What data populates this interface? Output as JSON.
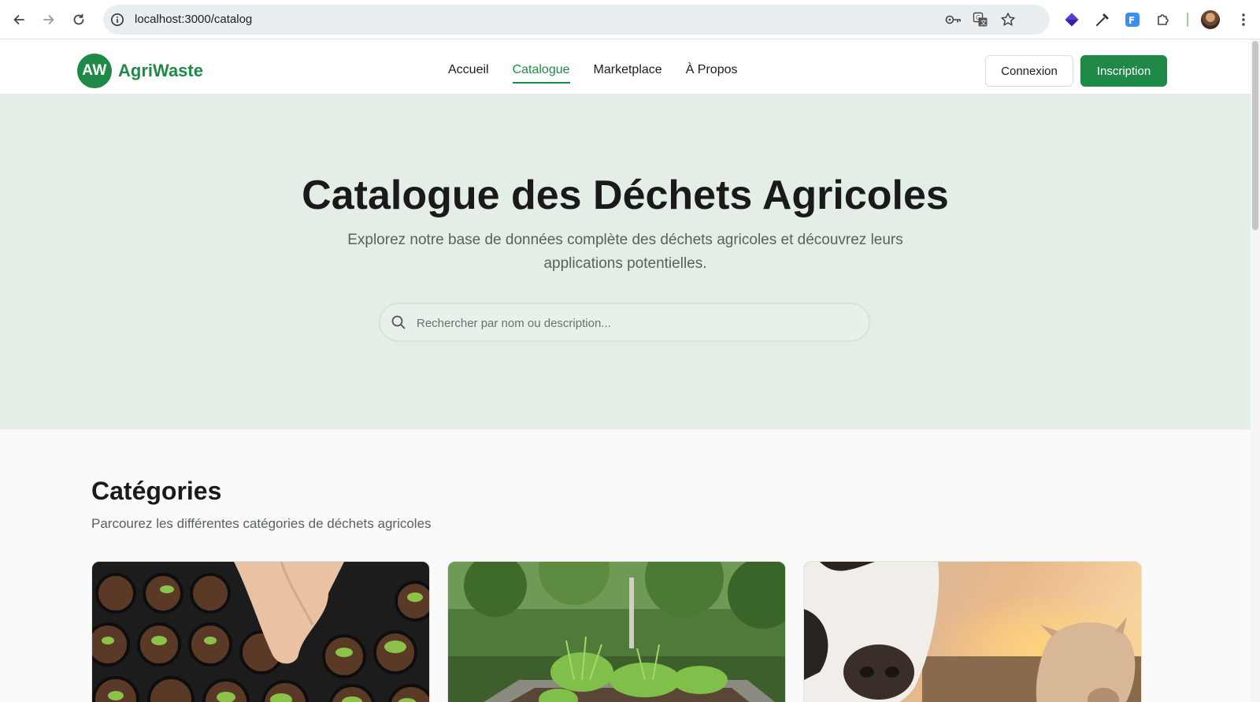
{
  "browser": {
    "url": "localhost:3000/catalog"
  },
  "site": {
    "logo_initials": "AW",
    "logo_name": "AgriWaste",
    "nav": [
      {
        "label": "Accueil",
        "active": false
      },
      {
        "label": "Catalogue",
        "active": true
      },
      {
        "label": "Marketplace",
        "active": false
      },
      {
        "label": "À Propos",
        "active": false
      }
    ],
    "login_label": "Connexion",
    "signup_label": "Inscription"
  },
  "hero": {
    "title": "Catalogue des Déchets Agricoles",
    "subtitle": "Explorez notre base de données complète des déchets agricoles et découvrez leurs applications potentielles.",
    "search_placeholder": "Rechercher par nom ou description..."
  },
  "categories": {
    "title": "Catégories",
    "subtitle": "Parcourez les différentes catégories de déchets agricoles",
    "cards": [
      {
        "image": "seedlings-tray-photo"
      },
      {
        "image": "raised-garden-bed-photo"
      },
      {
        "image": "cows-at-sunset-photo"
      }
    ]
  },
  "colors": {
    "brand_green": "#1f8a47",
    "hero_bg": "#e3eee7"
  }
}
